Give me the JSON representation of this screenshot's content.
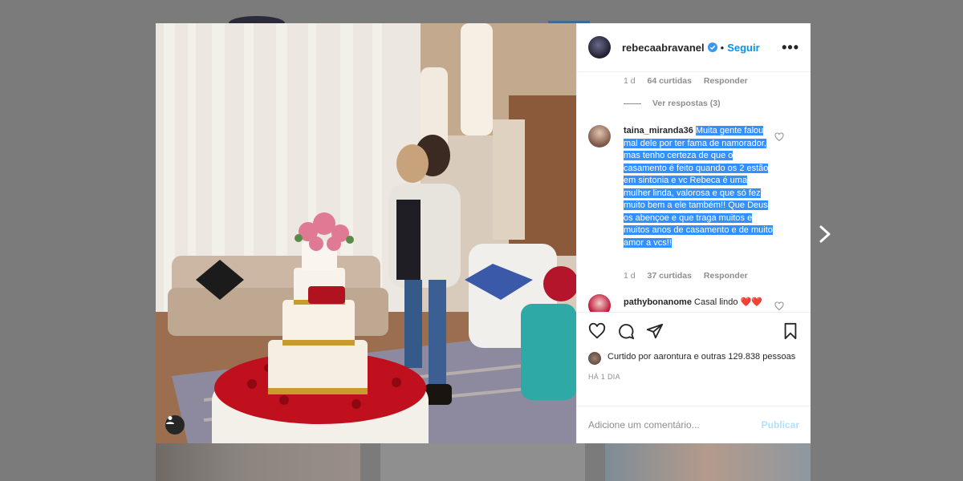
{
  "post": {
    "username": "rebecaabravanel",
    "follow_label": "Seguir",
    "more_label": "•••"
  },
  "comments": {
    "prev_meta": {
      "time": "1 d",
      "likes": "64 curtidas",
      "reply": "Responder"
    },
    "view_replies": "Ver respostas (3)",
    "items": [
      {
        "user": "taina_miranda36",
        "text": "Muita gente falou mal dele por ter fama de namorador, mas tenho certeza de que o casamento é feito quando os 2 estão em sintonia e vc Rebeca é uma mulher linda, valorosa e que só fez muito bem a ele também!! Que Deus os abençoe e que traga muitos e muitos anos de casamento e de muito amor a vcs!!",
        "time": "1 d",
        "likes": "37 curtidas",
        "reply": "Responder"
      },
      {
        "user": "pathybonanome",
        "text": "Casal lindo ❤️❤️"
      }
    ]
  },
  "likes": {
    "text": "Curtido por aarontura e outras 129.838 pessoas"
  },
  "date": "HÁ 1 DIA",
  "comment_box": {
    "placeholder": "Adicione um comentário...",
    "publish_label": "Publicar"
  },
  "colors": {
    "accent": "#0095f6",
    "highlight": "#3390ff",
    "heart": "#ed4956"
  }
}
